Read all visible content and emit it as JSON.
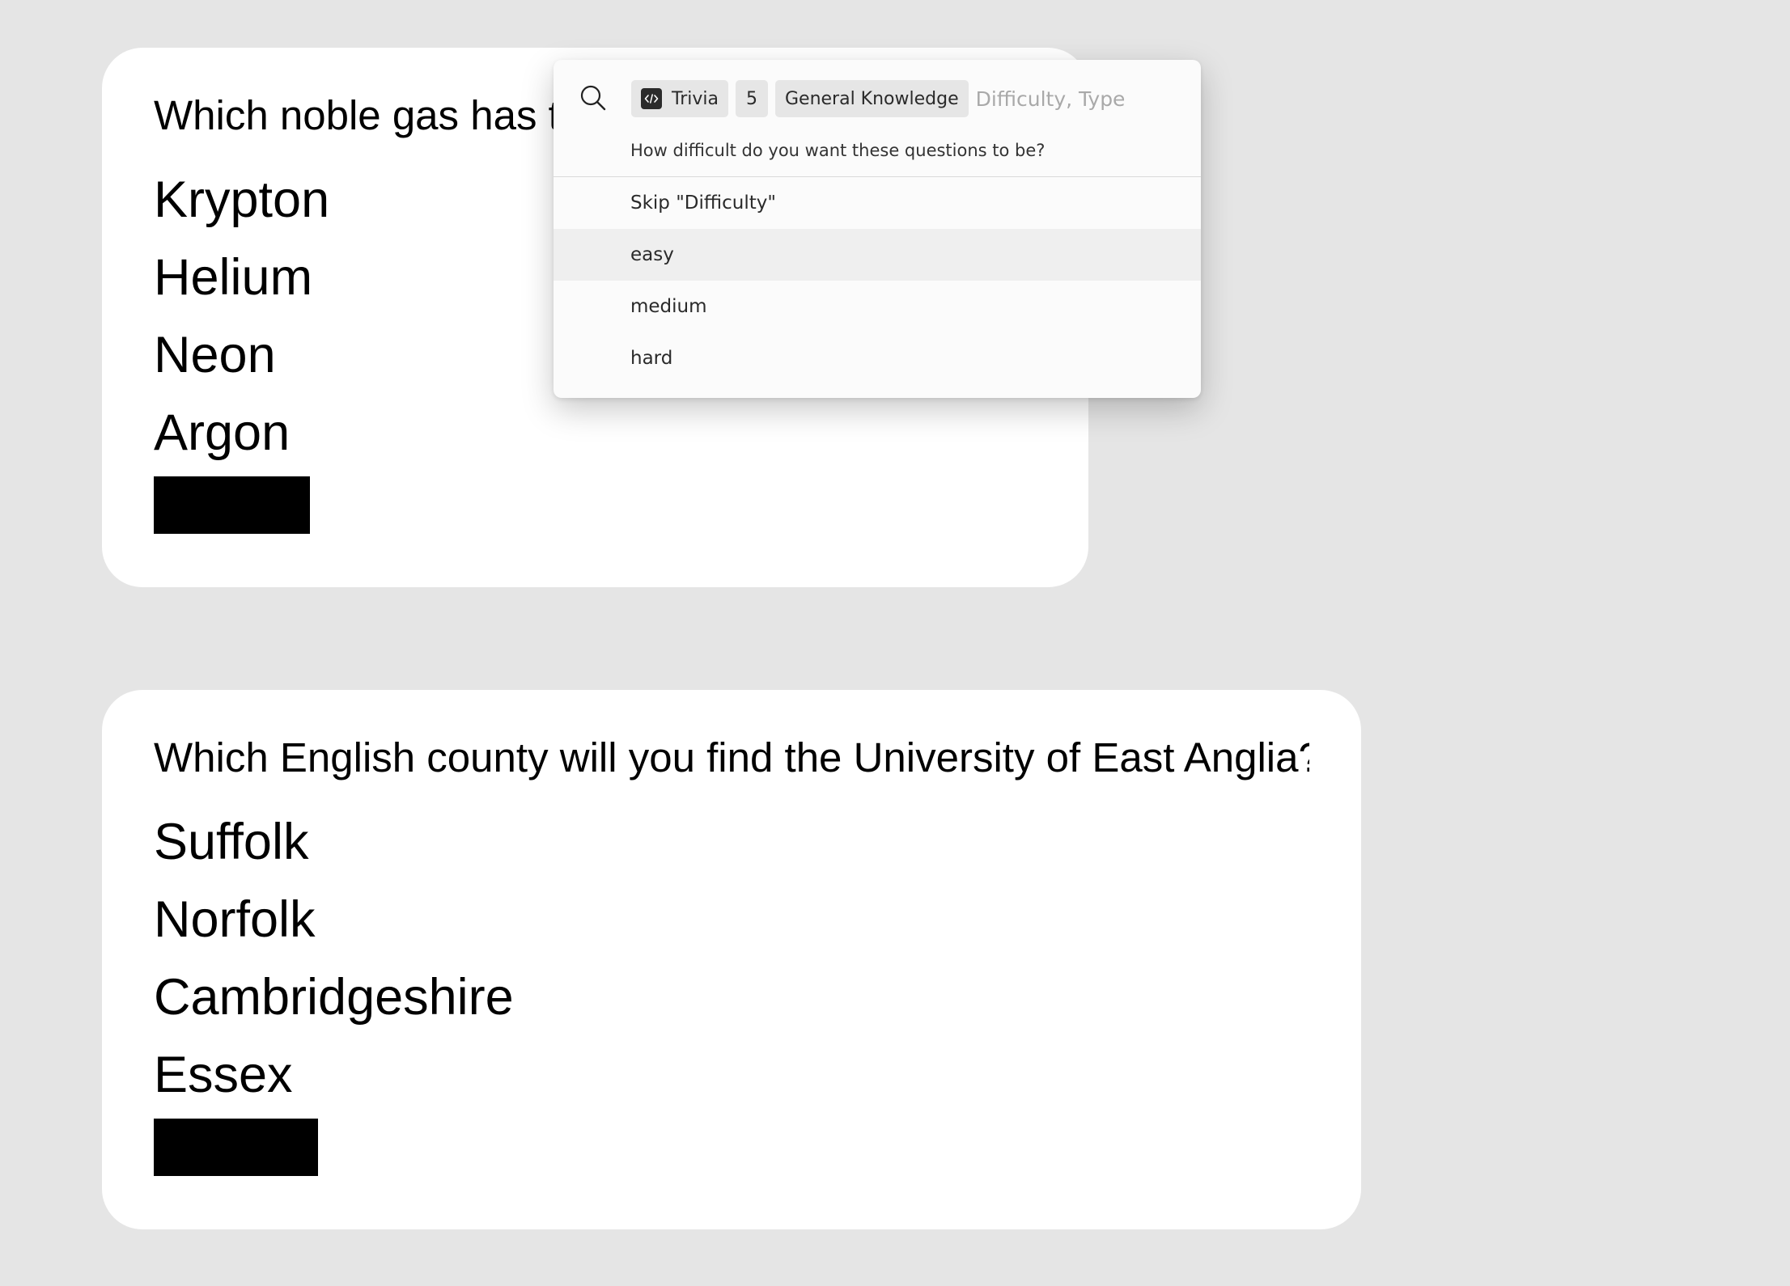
{
  "cards": [
    {
      "question": "Which noble gas has the lowest atomic number?",
      "answers": [
        "Krypton",
        "Helium",
        "Neon",
        "Argon"
      ]
    },
    {
      "question": "Which English county will you find the University of East Anglia?",
      "answers": [
        "Suffolk",
        "Norfolk",
        "Cambridgeshire",
        "Essex"
      ]
    }
  ],
  "palette": {
    "icons": {
      "search": "search-icon",
      "extension": "code-icon"
    },
    "tokens": {
      "extension_label": "Trivia",
      "amount": "5",
      "category": "General Knowledge"
    },
    "input": {
      "value": "",
      "placeholder": "Difficulty, Type"
    },
    "prompt": "How difficult do you want these questions to be?",
    "items": [
      {
        "label": "Skip \"Difficulty\""
      },
      {
        "label": "easy"
      },
      {
        "label": "medium"
      },
      {
        "label": "hard"
      }
    ],
    "selected_item": "easy"
  },
  "colors": {
    "background": "#e5e5e5",
    "card": "#ffffff",
    "redaction": "#000000",
    "token_bg": "#e6e6e6",
    "selected_row": "#efefef"
  }
}
